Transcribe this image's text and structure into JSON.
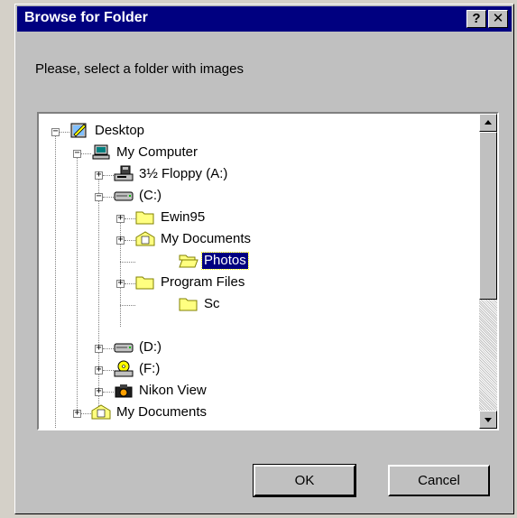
{
  "window": {
    "title": "Browse for Folder",
    "help_glyph": "?",
    "close_glyph": "✕"
  },
  "prompt": "Please, select a folder with images",
  "tree": {
    "items": [
      {
        "label": "Desktop",
        "icon": "desktop-icon"
      },
      {
        "label": "My Computer",
        "icon": "computer-icon"
      },
      {
        "label": "3½ Floppy (A:)",
        "icon": "floppy-drive-icon"
      },
      {
        "label": "(C:)",
        "icon": "hard-drive-icon"
      },
      {
        "label": "Ewin95",
        "icon": "folder-icon"
      },
      {
        "label": "My Documents",
        "icon": "my-documents-icon"
      },
      {
        "label": "Photos",
        "icon": "open-folder-icon",
        "selected": true
      },
      {
        "label": "Program Files",
        "icon": "folder-icon"
      },
      {
        "label": "Sc",
        "icon": "folder-icon"
      },
      {
        "label": "(D:)",
        "icon": "hard-drive-icon"
      },
      {
        "label": "(F:)",
        "icon": "cd-drive-icon"
      },
      {
        "label": "Nikon View",
        "icon": "camera-icon"
      },
      {
        "label": "My Documents",
        "icon": "my-documents-icon"
      }
    ]
  },
  "buttons": {
    "ok": "OK",
    "cancel": "Cancel"
  },
  "colors": {
    "titlebar": "#000080",
    "dialog_face": "#c0c0c0",
    "selection": "#000080",
    "folder_yellow": "#ffff80"
  }
}
